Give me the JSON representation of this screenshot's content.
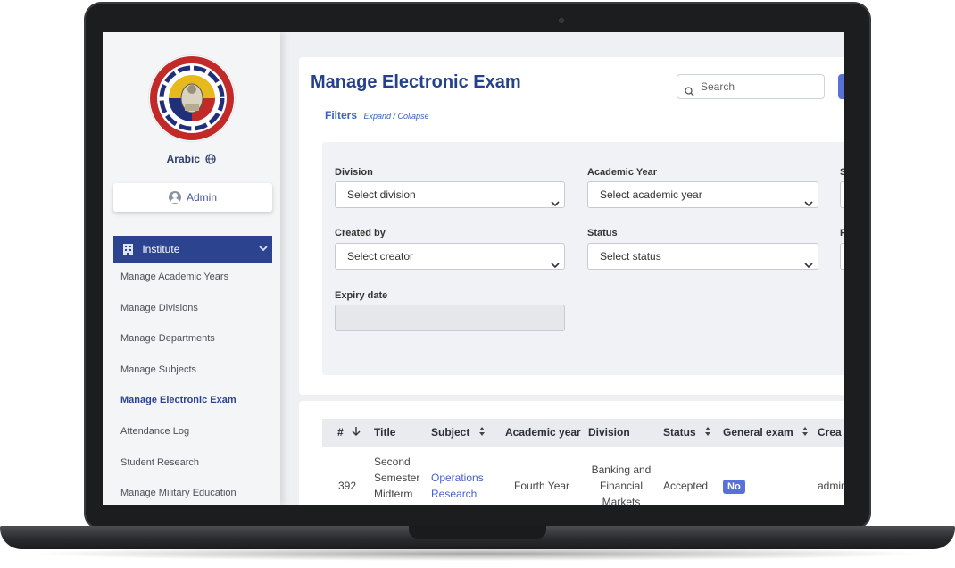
{
  "sidebar": {
    "language": "Arabic",
    "user": "Admin",
    "section": "Institute",
    "items": [
      {
        "label": "Manage Academic Years"
      },
      {
        "label": "Manage Divisions"
      },
      {
        "label": "Manage Departments"
      },
      {
        "label": "Manage Subjects"
      },
      {
        "label": "Manage Electronic Exam",
        "active": true
      },
      {
        "label": "Attendance Log"
      },
      {
        "label": "Student Research"
      },
      {
        "label": "Manage Military Education"
      }
    ]
  },
  "header": {
    "title": "Manage Electronic Exam",
    "search_placeholder": "Search",
    "filters_label": "Filters",
    "filters_toggle": "Expand / Collapse"
  },
  "filters": {
    "division": {
      "label": "Division",
      "value": "Select division"
    },
    "academic_year": {
      "label": "Academic Year",
      "value": "Select academic year"
    },
    "third_col_top_label": "S",
    "created_by": {
      "label": "Created by",
      "value": "Select creator"
    },
    "status": {
      "label": "Status",
      "value": "Select status"
    },
    "third_col_mid_label": "F",
    "expiry_date": {
      "label": "Expiry date",
      "value": ""
    }
  },
  "table": {
    "columns": [
      "#",
      "Title",
      "Subject",
      "Academic year",
      "Division",
      "Status",
      "General exam",
      "Crea"
    ],
    "rows": [
      {
        "id": "392",
        "title_lines": [
          "Second",
          "Semester",
          "Midterm"
        ],
        "subject_lines": [
          "Operations",
          "Research"
        ],
        "academic_year": "Fourth Year",
        "division_lines": [
          "Banking and",
          "Financial",
          "Markets"
        ],
        "status": "Accepted",
        "general_exam": "No",
        "created_by": "admin"
      }
    ]
  },
  "colors": {
    "accent": "#24428c",
    "menu_active_bg": "#2c4390",
    "badge": "#5870d8",
    "link": "#4563c7"
  }
}
